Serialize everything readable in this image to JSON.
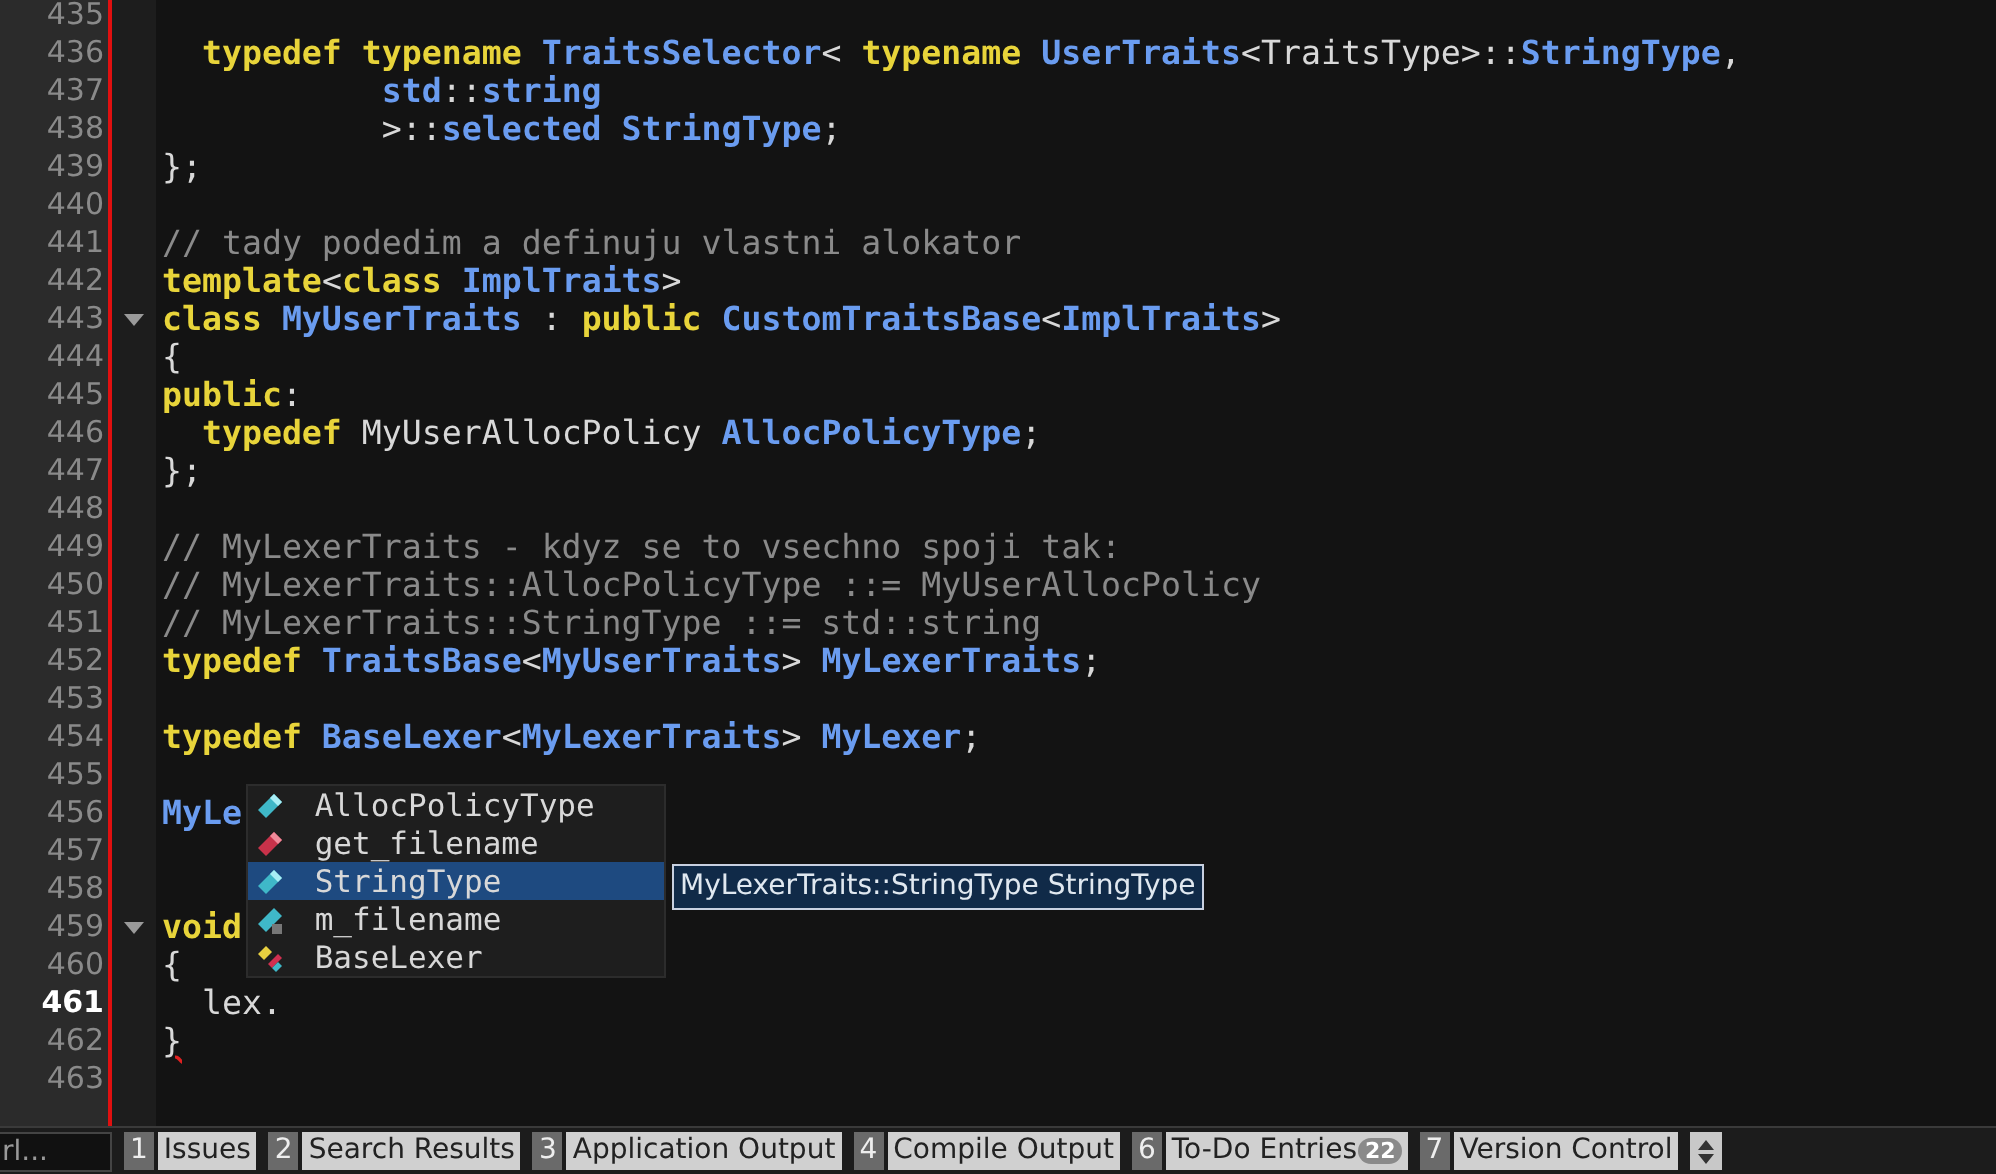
{
  "editor": {
    "lines": [
      {
        "number": "435",
        "foldable": false,
        "current": false
      },
      {
        "number": "436",
        "foldable": false,
        "current": false,
        "tokens": [
          {
            "text": "  typedef",
            "kind": "keyword"
          },
          {
            "text": " typename",
            "kind": "keyword"
          },
          {
            "text": " TraitsSelector",
            "kind": "type"
          },
          {
            "text": "< ",
            "kind": "plain"
          },
          {
            "text": "typename",
            "kind": "keyword"
          },
          {
            "text": " UserTraits",
            "kind": "type"
          },
          {
            "text": "<TraitsType>::",
            "kind": "plain"
          },
          {
            "text": "StringType",
            "kind": "type"
          },
          {
            "text": ",",
            "kind": "plain"
          }
        ]
      },
      {
        "number": "437",
        "foldable": false,
        "current": false,
        "tokens": [
          {
            "text": "           std",
            "kind": "type"
          },
          {
            "text": "::",
            "kind": "plain"
          },
          {
            "text": "string",
            "kind": "type"
          }
        ]
      },
      {
        "number": "438",
        "foldable": false,
        "current": false,
        "tokens": [
          {
            "text": "           >::",
            "kind": "plain"
          },
          {
            "text": "selected",
            "kind": "type"
          },
          {
            "text": " StringType",
            "kind": "type"
          },
          {
            "text": ";",
            "kind": "plain"
          }
        ]
      },
      {
        "number": "439",
        "foldable": false,
        "current": false,
        "tokens": [
          {
            "text": "};",
            "kind": "plain"
          }
        ]
      },
      {
        "number": "440",
        "foldable": false,
        "current": false
      },
      {
        "number": "441",
        "foldable": false,
        "current": false,
        "tokens": [
          {
            "text": "// tady podedim a definuju vlastni alokator",
            "kind": "comment"
          }
        ]
      },
      {
        "number": "442",
        "foldable": false,
        "current": false,
        "tokens": [
          {
            "text": "template",
            "kind": "keyword"
          },
          {
            "text": "<",
            "kind": "plain"
          },
          {
            "text": "class",
            "kind": "keyword"
          },
          {
            "text": " ImplTraits",
            "kind": "type"
          },
          {
            "text": ">",
            "kind": "plain"
          }
        ]
      },
      {
        "number": "443",
        "foldable": true,
        "current": false,
        "tokens": [
          {
            "text": "class",
            "kind": "keyword"
          },
          {
            "text": " MyUserTraits",
            "kind": "type"
          },
          {
            "text": " : ",
            "kind": "plain"
          },
          {
            "text": "public",
            "kind": "keyword"
          },
          {
            "text": " CustomTraitsBase",
            "kind": "type"
          },
          {
            "text": "<",
            "kind": "plain"
          },
          {
            "text": "ImplTraits",
            "kind": "type"
          },
          {
            "text": ">",
            "kind": "plain"
          }
        ]
      },
      {
        "number": "444",
        "foldable": false,
        "current": false,
        "tokens": [
          {
            "text": "{",
            "kind": "plain"
          }
        ]
      },
      {
        "number": "445",
        "foldable": false,
        "current": false,
        "tokens": [
          {
            "text": "public",
            "kind": "keyword"
          },
          {
            "text": ":",
            "kind": "plain"
          }
        ]
      },
      {
        "number": "446",
        "foldable": false,
        "current": false,
        "tokens": [
          {
            "text": "  typedef",
            "kind": "keyword"
          },
          {
            "text": " MyUserAllocPolicy ",
            "kind": "plain"
          },
          {
            "text": "AllocPolicyType",
            "kind": "type"
          },
          {
            "text": ";",
            "kind": "plain"
          }
        ]
      },
      {
        "number": "447",
        "foldable": false,
        "current": false,
        "tokens": [
          {
            "text": "};",
            "kind": "plain"
          }
        ]
      },
      {
        "number": "448",
        "foldable": false,
        "current": false
      },
      {
        "number": "449",
        "foldable": false,
        "current": false,
        "tokens": [
          {
            "text": "// MyLexerTraits - kdyz se to vsechno spoji tak:",
            "kind": "comment"
          }
        ]
      },
      {
        "number": "450",
        "foldable": false,
        "current": false,
        "tokens": [
          {
            "text": "// MyLexerTraits::AllocPolicyType ::= MyUserAllocPolicy",
            "kind": "comment"
          }
        ]
      },
      {
        "number": "451",
        "foldable": false,
        "current": false,
        "tokens": [
          {
            "text": "// MyLexerTraits::StringType ::= std::string",
            "kind": "comment"
          }
        ]
      },
      {
        "number": "452",
        "foldable": false,
        "current": false,
        "tokens": [
          {
            "text": "typedef",
            "kind": "keyword"
          },
          {
            "text": " TraitsBase",
            "kind": "type"
          },
          {
            "text": "<",
            "kind": "plain"
          },
          {
            "text": "MyUserTraits",
            "kind": "type"
          },
          {
            "text": "> ",
            "kind": "plain"
          },
          {
            "text": "MyLexerTraits",
            "kind": "type"
          },
          {
            "text": ";",
            "kind": "plain"
          }
        ]
      },
      {
        "number": "453",
        "foldable": false,
        "current": false
      },
      {
        "number": "454",
        "foldable": false,
        "current": false,
        "tokens": [
          {
            "text": "typedef",
            "kind": "keyword"
          },
          {
            "text": " BaseLexer",
            "kind": "type"
          },
          {
            "text": "<",
            "kind": "plain"
          },
          {
            "text": "MyLexerTraits",
            "kind": "type"
          },
          {
            "text": "> ",
            "kind": "plain"
          },
          {
            "text": "MyLexer",
            "kind": "type"
          },
          {
            "text": ";",
            "kind": "plain"
          }
        ]
      },
      {
        "number": "455",
        "foldable": false,
        "current": false
      },
      {
        "number": "456",
        "foldable": false,
        "current": false,
        "tokens": [
          {
            "text": "MyLe",
            "kind": "type"
          }
        ]
      },
      {
        "number": "457",
        "foldable": false,
        "current": false
      },
      {
        "number": "458",
        "foldable": false,
        "current": false
      },
      {
        "number": "459",
        "foldable": true,
        "current": false,
        "tokens": [
          {
            "text": "void",
            "kind": "keyword"
          }
        ]
      },
      {
        "number": "460",
        "foldable": false,
        "current": false,
        "tokens": [
          {
            "text": "{",
            "kind": "plain"
          }
        ]
      },
      {
        "number": "461",
        "foldable": false,
        "current": true,
        "tokens": [
          {
            "text": "  lex.",
            "kind": "plain"
          }
        ]
      },
      {
        "number": "462",
        "foldable": false,
        "current": false,
        "tokens": [
          {
            "text": "}",
            "kind": "error"
          }
        ]
      },
      {
        "number": "463",
        "foldable": false,
        "current": false
      }
    ]
  },
  "completion": {
    "items": [
      {
        "label": "AllocPolicyType",
        "kind": "type",
        "selected": false
      },
      {
        "label": "get_filename",
        "kind": "function",
        "selected": false
      },
      {
        "label": "StringType",
        "kind": "type",
        "selected": true
      },
      {
        "label": "m_filename",
        "kind": "member",
        "selected": false
      },
      {
        "label": "BaseLexer",
        "kind": "class",
        "selected": false
      }
    ],
    "tooltip": "MyLexerTraits::StringType StringType"
  },
  "status_bar": {
    "locator": {
      "placeholder": "rl..."
    },
    "tabs": [
      {
        "number": "1",
        "label": "Issues"
      },
      {
        "number": "2",
        "label": "Search Results"
      },
      {
        "number": "3",
        "label": "Application Output"
      },
      {
        "number": "4",
        "label": "Compile Output"
      },
      {
        "number": "6",
        "label": "To-Do Entries",
        "badge": "22"
      },
      {
        "number": "7",
        "label": "Version Control"
      }
    ]
  }
}
